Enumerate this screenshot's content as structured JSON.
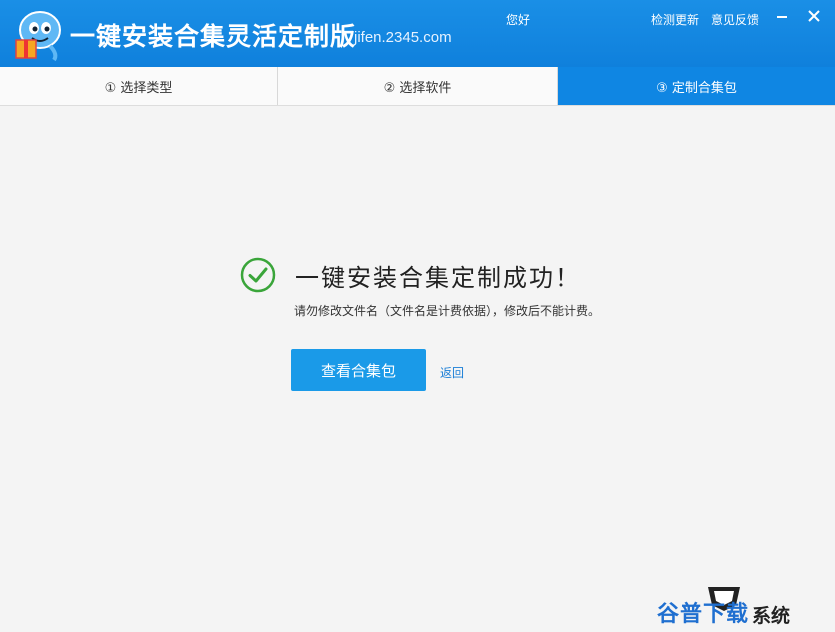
{
  "window": {
    "title": "一键安装合集灵活定制版",
    "site": "jifen.2345.com",
    "greeting": "您好",
    "links": {
      "check_update": "检测更新",
      "feedback": "意见反馈"
    }
  },
  "tabs": [
    {
      "label": "① 选择类型",
      "active": false
    },
    {
      "label": "② 选择软件",
      "active": false
    },
    {
      "label": "③ 定制合集包",
      "active": true
    }
  ],
  "main": {
    "success_title": "一键安装合集定制成功！",
    "note": "请勿修改文件名（文件名是计费依据），修改后不能计费。",
    "view_button": "查看合集包",
    "back_link": "返回"
  },
  "watermark": {
    "text_blue": "谷普下载",
    "text_dark": "系统"
  },
  "colors": {
    "titlebar": "#0f80dc",
    "active_tab": "#0f86e3",
    "primary_button": "#1a9ae8",
    "success_green": "#3aa53a"
  },
  "icons": {
    "logo": "octopus-gift-logo",
    "minimize": "minimize-icon",
    "close": "close-icon",
    "success": "check-circle-icon"
  }
}
